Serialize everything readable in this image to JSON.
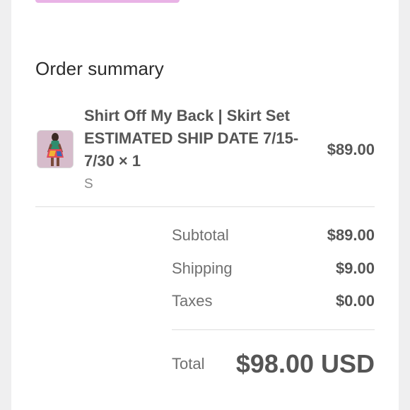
{
  "order_summary": {
    "heading": "Order summary",
    "item": {
      "name": "Shirt Off My Back | Skirt Set ESTIMATED SHIP DATE 7/15-7/30 × 1",
      "variant": "S",
      "price": "$89.00",
      "thumbnail_icon": "product-photo"
    },
    "subtotal": {
      "label": "Subtotal",
      "value": "$89.00"
    },
    "shipping": {
      "label": "Shipping",
      "value": "$9.00"
    },
    "taxes": {
      "label": "Taxes",
      "value": "$0.00"
    },
    "total": {
      "label": "Total",
      "value": "$98.00 USD"
    }
  },
  "colors": {
    "accent_bar": "#e9b3e6",
    "text_dark": "#555555",
    "text_muted": "#707070"
  }
}
